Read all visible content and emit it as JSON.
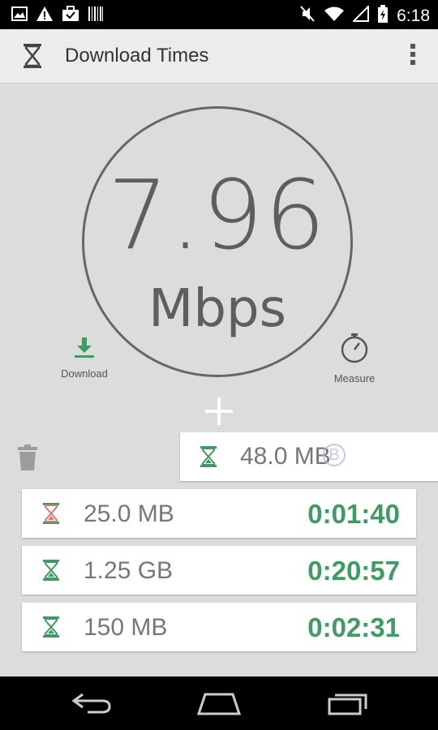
{
  "status_bar": {
    "time": "6:18",
    "icons": [
      "image-icon",
      "warning-icon",
      "briefcase-icon",
      "barcode-icon",
      "mute-icon",
      "wifi-icon",
      "signal-icon",
      "battery-charging-icon"
    ]
  },
  "action_bar": {
    "title": "Download Times",
    "icon": "hourglass-icon",
    "overflow_icon": "overflow-menu-icon"
  },
  "gauge": {
    "value": "7.96",
    "unit": "Mbps"
  },
  "download_button": {
    "label": "Download",
    "icon": "download-arrow-icon"
  },
  "measure_button": {
    "label": "Measure",
    "icon": "stopwatch-icon"
  },
  "add_icon": "plus-icon",
  "delete_icon": "trash-icon",
  "new_entry": {
    "value": "48.0 MB",
    "unit_toggle": "B"
  },
  "items": [
    {
      "size": "25.0 MB",
      "time": "0:01:40",
      "hourglass_color": "#d97a6c"
    },
    {
      "size": "1.25 GB",
      "time": "0:20:57",
      "hourglass_color": "#3f9b62"
    },
    {
      "size": "150 MB",
      "time": "0:02:31",
      "hourglass_color": "#3f9b62"
    }
  ],
  "colors": {
    "accent_green": "#3f9b62",
    "background": "#dcdcdc",
    "gauge_text": "#5e5e5e"
  },
  "nav_bar": {
    "icons": [
      "back-icon",
      "home-icon",
      "recent-apps-icon"
    ]
  }
}
